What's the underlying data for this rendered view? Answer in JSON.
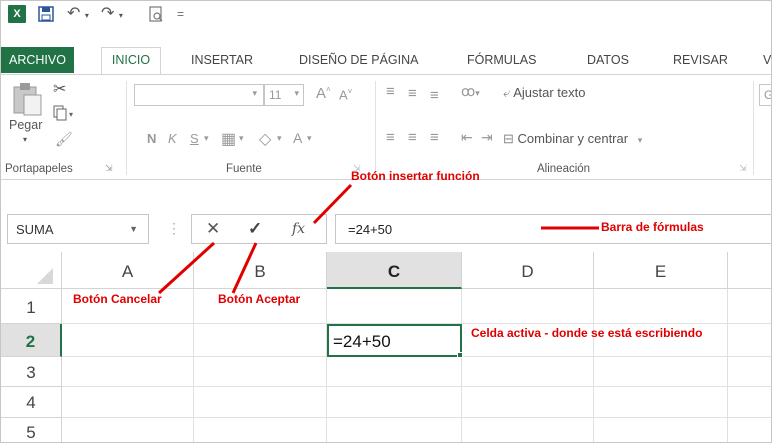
{
  "qat": {
    "logo_text": "X",
    "more": "="
  },
  "tabs": [
    "ARCHIVO",
    "INICIO",
    "INSERTAR",
    "DISEÑO DE PÁGINA",
    "FÓRMULAS",
    "DATOS",
    "REVISAR",
    "V"
  ],
  "ribbon": {
    "paste_label": "Pegar",
    "font_size": "11",
    "grow_font": "A",
    "shrink_font": "A",
    "bold": "N",
    "italic": "K",
    "underline": "S",
    "font_color": "A",
    "wrap_text": "Ajustar texto",
    "merge_center": "Combinar y centrar",
    "general_cut": "G",
    "groups": {
      "clipboard": "Portapapeles",
      "font": "Fuente",
      "alignment": "Alineación"
    }
  },
  "formula_bar": {
    "name_box": "SUMA",
    "cancel_symbol": "✕",
    "enter_symbol": "✓",
    "fx_symbol": "fx",
    "formula": "=24+50"
  },
  "grid": {
    "columns": [
      "A",
      "B",
      "C",
      "D",
      "E"
    ],
    "rows": [
      "1",
      "2",
      "3",
      "4",
      "5"
    ],
    "active_cell_value": "=24+50"
  },
  "annotations": {
    "insert_function": "Botón insertar función",
    "formula_bar": "Barra de fórmulas",
    "cancel": "Botón Cancelar",
    "accept": "Botón Aceptar",
    "active_cell": "Celda activa - donde se está escribiendo"
  },
  "colors": {
    "excel_green": "#217346",
    "annotation_red": "#e00000"
  }
}
